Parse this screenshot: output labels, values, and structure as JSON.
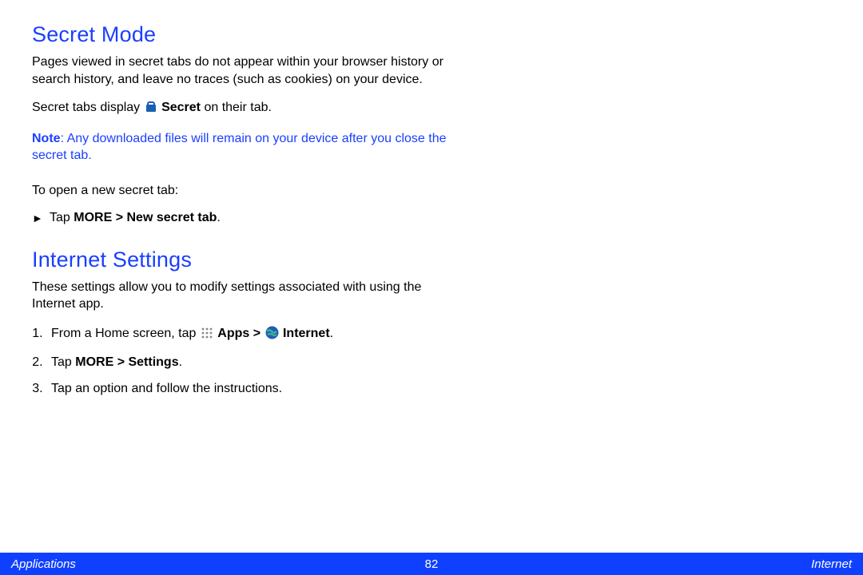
{
  "section1": {
    "heading": "Secret Mode",
    "para1": "Pages viewed in secret tabs do not appear within your browser history or search history, and leave no traces (such as cookies) on your device.",
    "para2_pre": "Secret tabs display ",
    "para2_bold": "Secret",
    "para2_post": " on their tab.",
    "note_label": "Note",
    "note_text": ": Any downloaded files will remain on your device after you close the secret tab.",
    "lead": "To open a new secret tab:",
    "bullet_pre": "Tap ",
    "bullet_bold": "MORE > New secret tab",
    "bullet_post": "."
  },
  "section2": {
    "heading": "Internet Settings",
    "para1": "These settings allow you to modify settings associated with using the Internet app.",
    "step1_pre": "From a Home screen, tap ",
    "step1_apps": "Apps > ",
    "step1_internet": "Internet",
    "step1_post": ".",
    "step2_pre": "Tap ",
    "step2_bold": "MORE > Settings",
    "step2_post": ".",
    "step3": "Tap an option and follow the instructions."
  },
  "footer": {
    "left": "Applications",
    "center": "82",
    "right": "Internet"
  },
  "icons": {
    "secret": "secret-icon",
    "apps": "apps-grid-icon",
    "internet": "globe-icon"
  }
}
